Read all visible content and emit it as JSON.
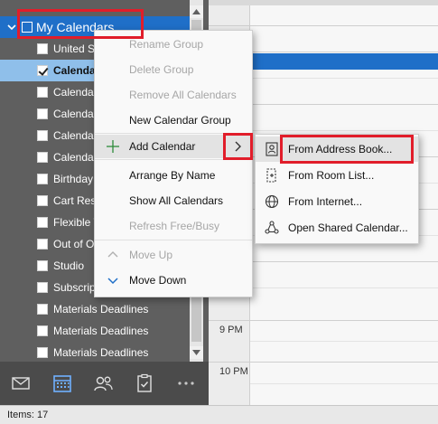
{
  "navigation": {
    "group": {
      "label": "My Calendars",
      "expanded": true,
      "checked": false
    },
    "calendars": [
      {
        "label": "United S",
        "checked": false,
        "selected": false
      },
      {
        "label": "Calenda",
        "checked": true,
        "selected": true
      },
      {
        "label": "Calenda",
        "checked": false,
        "selected": false
      },
      {
        "label": "Calenda",
        "checked": false,
        "selected": false
      },
      {
        "label": "Calenda",
        "checked": false,
        "selected": false
      },
      {
        "label": "Calenda",
        "checked": false,
        "selected": false
      },
      {
        "label": "Birthday",
        "checked": false,
        "selected": false
      },
      {
        "label": "Cart Res",
        "checked": false,
        "selected": false
      },
      {
        "label": "Flexible T",
        "checked": false,
        "selected": false
      },
      {
        "label": "Out of O",
        "checked": false,
        "selected": false
      },
      {
        "label": "Studio",
        "checked": false,
        "selected": false
      },
      {
        "label": "Subscrip",
        "checked": false,
        "selected": false
      },
      {
        "label": "Materials Deadlines",
        "checked": false,
        "selected": false
      },
      {
        "label": "Materials Deadlines",
        "checked": false,
        "selected": false
      },
      {
        "label": "Materials Deadlines",
        "checked": false,
        "selected": false
      }
    ]
  },
  "modules": [
    {
      "name": "mail-icon"
    },
    {
      "name": "calendar-icon",
      "active": true
    },
    {
      "name": "people-icon"
    },
    {
      "name": "tasks-icon"
    },
    {
      "name": "more-icon"
    }
  ],
  "calendar_grid": {
    "time_labels": [
      "9 PM",
      "10 PM"
    ]
  },
  "context_menu": {
    "items": [
      {
        "label": "Rename Group",
        "disabled": true
      },
      {
        "label": "Delete Group",
        "disabled": true
      },
      {
        "label": "Remove All Calendars",
        "disabled": true
      },
      {
        "label": "New Calendar Group",
        "disabled": false
      },
      {
        "label": "Add Calendar",
        "disabled": false,
        "has_submenu": true,
        "icon": "plus-icon"
      },
      {
        "label": "Arrange By Name",
        "disabled": false
      },
      {
        "label": "Show All Calendars",
        "disabled": false
      },
      {
        "label": "Refresh Free/Busy",
        "disabled": true
      },
      {
        "label": "Move Up",
        "disabled": true,
        "icon": "chevron-up-icon"
      },
      {
        "label": "Move Down",
        "disabled": false,
        "icon": "chevron-down-icon"
      }
    ]
  },
  "submenu": {
    "items": [
      {
        "label": "From Address Book...",
        "icon": "address-book-icon",
        "highlighted": true
      },
      {
        "label": "From Room List...",
        "icon": "room-list-icon"
      },
      {
        "label": "From Internet...",
        "icon": "globe-icon"
      },
      {
        "label": "Open Shared Calendar...",
        "icon": "shared-calendar-icon"
      }
    ]
  },
  "status_bar": {
    "items_text": "Items: 17"
  },
  "colors": {
    "accent_blue": "#1f6fc8",
    "selected_row": "#8fbfea",
    "annotation_red": "#e11d2a"
  }
}
